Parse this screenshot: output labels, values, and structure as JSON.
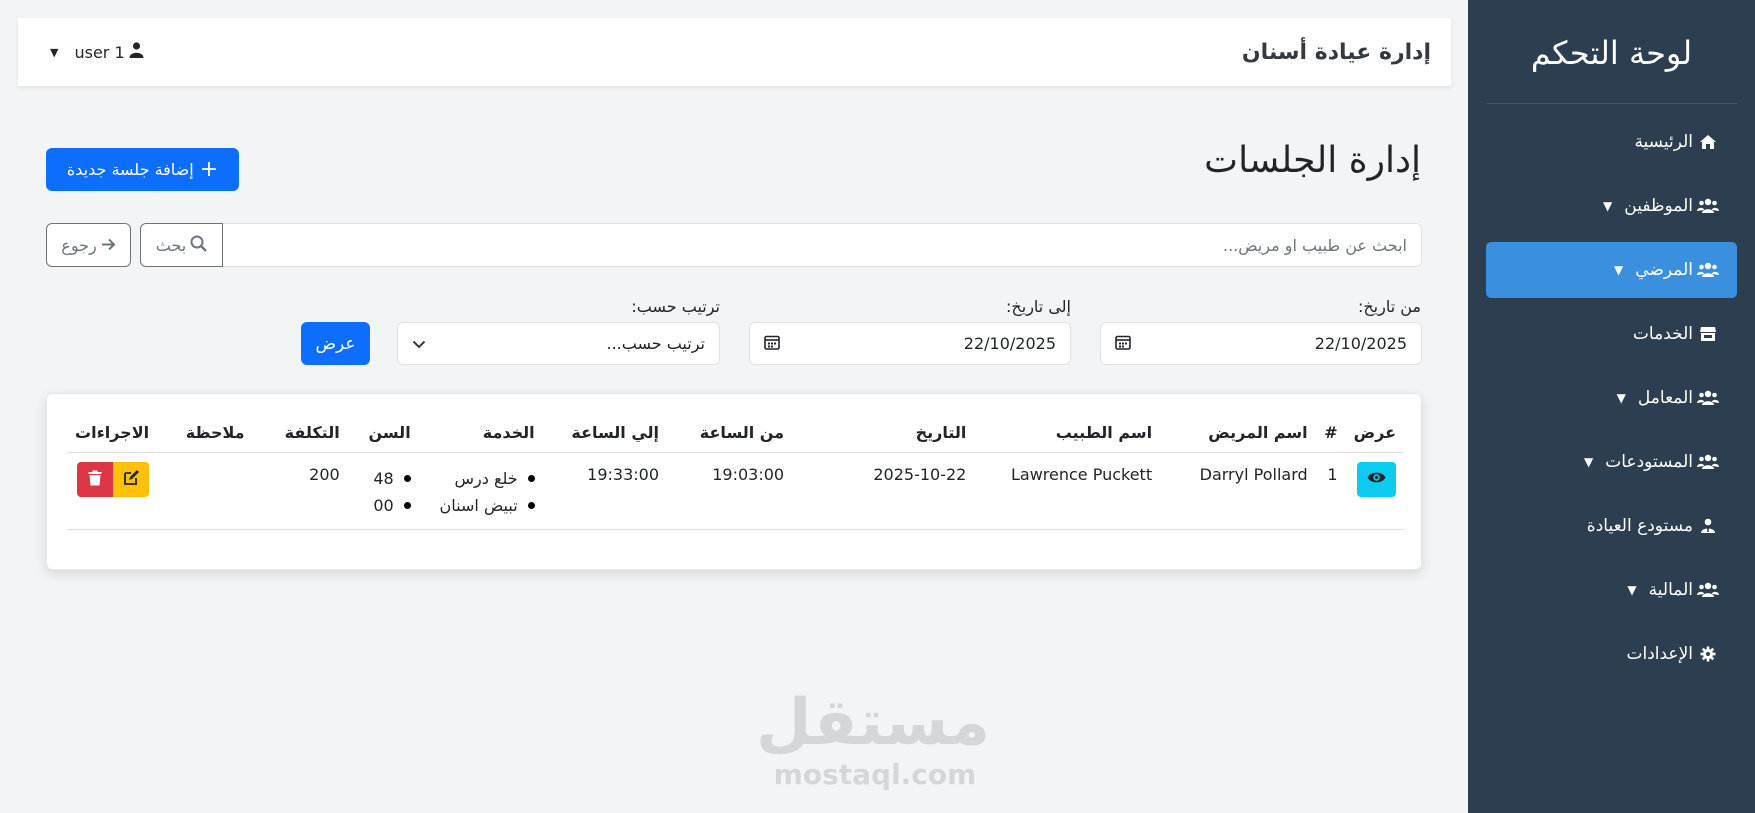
{
  "sidebar": {
    "title": "لوحة التحكم",
    "items": [
      {
        "label": "الرئيسية",
        "icon": "home-icon",
        "has_caret": false,
        "active": false
      },
      {
        "label": "الموظفين",
        "icon": "users-icon",
        "has_caret": true,
        "active": false
      },
      {
        "label": "المرضي",
        "icon": "users-icon",
        "has_caret": true,
        "active": true
      },
      {
        "label": "الخدمات",
        "icon": "store-icon",
        "has_caret": false,
        "active": false
      },
      {
        "label": "المعامل",
        "icon": "users-icon",
        "has_caret": true,
        "active": false
      },
      {
        "label": "المستودعات",
        "icon": "users-icon",
        "has_caret": true,
        "active": false
      },
      {
        "label": "مستودع العيادة",
        "icon": "user-tie-icon",
        "has_caret": false,
        "active": false
      },
      {
        "label": "المالية",
        "icon": "users-icon",
        "has_caret": true,
        "active": false
      },
      {
        "label": "الإعدادات",
        "icon": "gear-icon",
        "has_caret": false,
        "active": false
      }
    ]
  },
  "topbar": {
    "brand": "إدارة عيادة أسنان",
    "user": "user 1"
  },
  "page": {
    "title": "إدارة الجلسات",
    "add_button": "إضافة جلسة جديدة"
  },
  "search": {
    "placeholder": "ابحث عن طبيب او مريض...",
    "search_label": "بحث",
    "back_label": "رجوع"
  },
  "filters": {
    "from_label": "من تاريخ:",
    "from_value": "22/10/2025",
    "to_label": "إلى تاريخ:",
    "to_value": "22/10/2025",
    "sort_label": "ترتيب حسب:",
    "sort_value": "ترتيب حسب...",
    "show_label": "عرض"
  },
  "table": {
    "headers": {
      "view": "عرض",
      "num": "#",
      "patient": "اسم المريض",
      "doctor": "اسم الطبيب",
      "date": "التاريخ",
      "from_time": "من الساعة",
      "to_time": "إلي الساعة",
      "service": "الخدمة",
      "tooth": "السن",
      "cost": "التكلفة",
      "note": "ملاحظة",
      "actions": "الاجراءات"
    },
    "rows": [
      {
        "num": "1",
        "patient": "Darryl Pollard",
        "doctor": "Lawrence Puckett",
        "date": "2025-10-22",
        "from_time": "19:03:00",
        "to_time": "19:33:00",
        "services": [
          "خلع درس",
          "تبيض اسنان"
        ],
        "teeth": [
          "48",
          "00"
        ],
        "cost": "200",
        "note": ""
      }
    ]
  },
  "watermark": {
    "arabic": "مستقل",
    "latin": "mostaql.com"
  },
  "colors": {
    "sidebar_bg": "#2c3e50",
    "active_item": "#3b8fdf",
    "primary": "#0d6efd",
    "info": "#0dcaf0",
    "warning": "#ffc107",
    "danger": "#dc3545"
  }
}
